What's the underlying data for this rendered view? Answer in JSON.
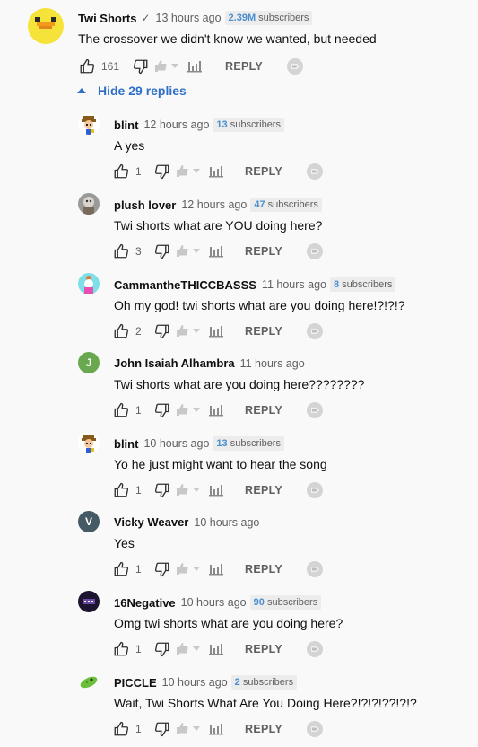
{
  "top_comment": {
    "author": "Twi Shorts",
    "verified_mark": "✓",
    "time": "13 hours ago",
    "subs_count": "2.39M",
    "subs_word": "subscribers",
    "text": "The crossover we didn't know we wanted, but needed",
    "likes": "161",
    "reply_label": "REPLY",
    "avatar_color": "#f5e33a"
  },
  "toggle_replies": {
    "label": "Hide 29 replies",
    "icon": "caret-up-icon"
  },
  "replies": [
    {
      "author": "blint",
      "time": "12 hours ago",
      "subs_count": "13",
      "subs_word": "subscribers",
      "text": "A yes",
      "likes": "1",
      "reply_label": "REPLY"
    },
    {
      "author": "plush lover",
      "time": "12 hours ago",
      "subs_count": "47",
      "subs_word": "subscribers",
      "text": "Twi shorts what are YOU doing here?",
      "likes": "3",
      "reply_label": "REPLY"
    },
    {
      "author": "CammantheTHICCBASSS",
      "time": "11 hours ago",
      "subs_count": "8",
      "subs_word": "subscribers",
      "text": "Oh my god! twi shorts what are you doing here!?!?!?",
      "likes": "2",
      "reply_label": "REPLY"
    },
    {
      "author": "John Isaiah Alhambra",
      "time": "11 hours ago",
      "avatar_letter": "J",
      "text": "Twi shorts what are you doing here????????",
      "likes": "1",
      "reply_label": "REPLY"
    },
    {
      "author": "blint",
      "time": "10 hours ago",
      "subs_count": "13",
      "subs_word": "subscribers",
      "text": "Yo he just might want to hear the song",
      "likes": "1",
      "reply_label": "REPLY"
    },
    {
      "author": "Vicky Weaver",
      "time": "10 hours ago",
      "avatar_letter": "V",
      "text": "Yes",
      "likes": "1",
      "reply_label": "REPLY"
    },
    {
      "author": "16Negative",
      "time": "10 hours ago",
      "subs_count": "90",
      "subs_word": "subscribers",
      "text": "Omg twi shorts what are you doing here?",
      "likes": "1",
      "reply_label": "REPLY"
    },
    {
      "author": "PICCLE",
      "time": "10 hours ago",
      "subs_count": "2",
      "subs_word": "subscribers",
      "text": "Wait, Twi Shorts What Are You Doing Here?!?!?!??!?!?",
      "likes": "1",
      "reply_label": "REPLY"
    }
  ],
  "colors": {
    "link_blue": "#2f6fc8",
    "secondary_text": "#606060",
    "john_avatar": "#6aa84f",
    "vicky_avatar": "#455a64"
  }
}
